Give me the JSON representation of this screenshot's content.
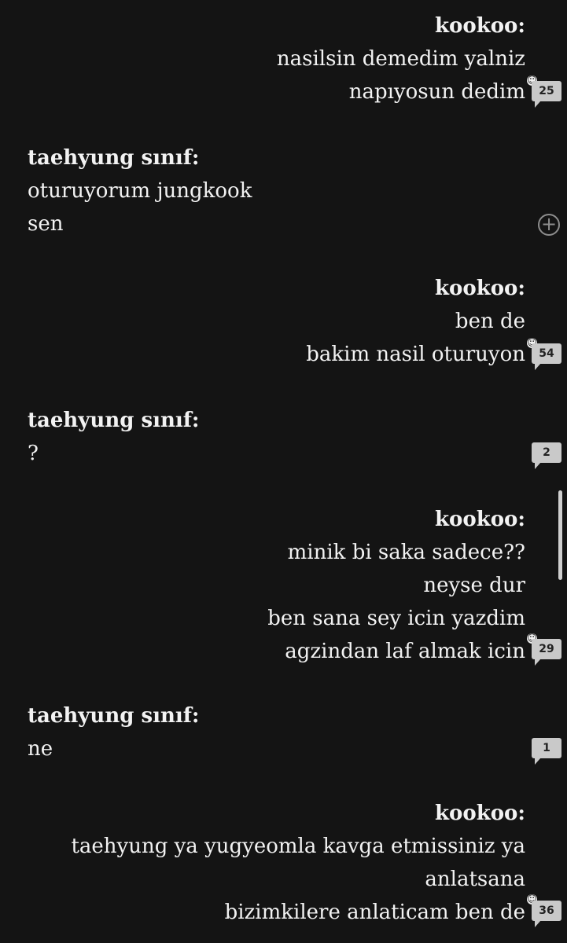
{
  "messages": [
    {
      "speaker": "kookoo:",
      "lines": [
        "nasilsin demedim yalniz",
        "napıyosun dedim"
      ],
      "comment_count": "25"
    },
    {
      "speaker": "taehyung sınıf:",
      "lines": [
        "oturuyorum jungkook",
        "sen"
      ]
    },
    {
      "speaker": "kookoo:",
      "lines": [
        "ben de",
        "bakim nasil oturuyon"
      ],
      "comment_count": "54"
    },
    {
      "speaker": "taehyung sınıf:",
      "lines": [
        "?"
      ],
      "comment_count": "2"
    },
    {
      "speaker": "kookoo:",
      "lines": [
        "minik bi saka sadece??",
        "neyse dur",
        "ben sana sey icin yazdim",
        "agzindan laf almak icin"
      ],
      "comment_count": "29"
    },
    {
      "speaker": "taehyung sınıf:",
      "lines": [
        "ne"
      ],
      "comment_count": "1"
    },
    {
      "speaker": "kookoo:",
      "lines": [
        "taehyung ya yugyeomla kavga etmissiniz ya",
        "anlatsana",
        "bizimkilere anlaticam ben de"
      ],
      "comment_count": "36"
    }
  ],
  "icons": {
    "smiley": "☺",
    "add": "+"
  },
  "colors": {
    "background": "#141414",
    "text": "#f2f2f2",
    "bubble": "#c9c9c9"
  }
}
